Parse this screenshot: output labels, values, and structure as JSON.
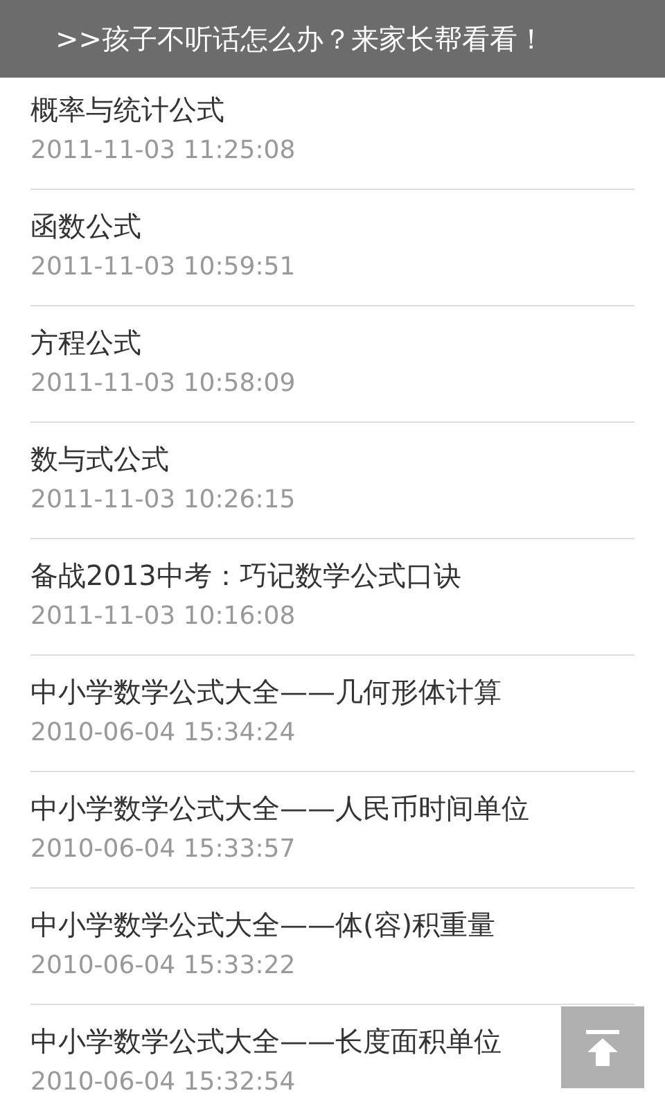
{
  "banner": {
    "text": ">>孩子不听话怎么办？来家长帮看看！"
  },
  "articles": [
    {
      "title": "概率与统计公式",
      "date": "2011-11-03 11:25:08"
    },
    {
      "title": "函数公式",
      "date": "2011-11-03 10:59:51"
    },
    {
      "title": "方程公式",
      "date": "2011-11-03 10:58:09"
    },
    {
      "title": "数与式公式",
      "date": "2011-11-03 10:26:15"
    },
    {
      "title": "备战2013中考：巧记数学公式口诀",
      "date": "2011-11-03 10:16:08"
    },
    {
      "title": "中小学数学公式大全——几何形体计算",
      "date": "2010-06-04 15:34:24"
    },
    {
      "title": "中小学数学公式大全——人民币时间单位",
      "date": "2010-06-04 15:33:57"
    },
    {
      "title": "中小学数学公式大全——体(容)积重量",
      "date": "2010-06-04 15:33:22"
    },
    {
      "title": "中小学数学公式大全——长度面积单位",
      "date": "2010-06-04 15:32:54"
    }
  ]
}
